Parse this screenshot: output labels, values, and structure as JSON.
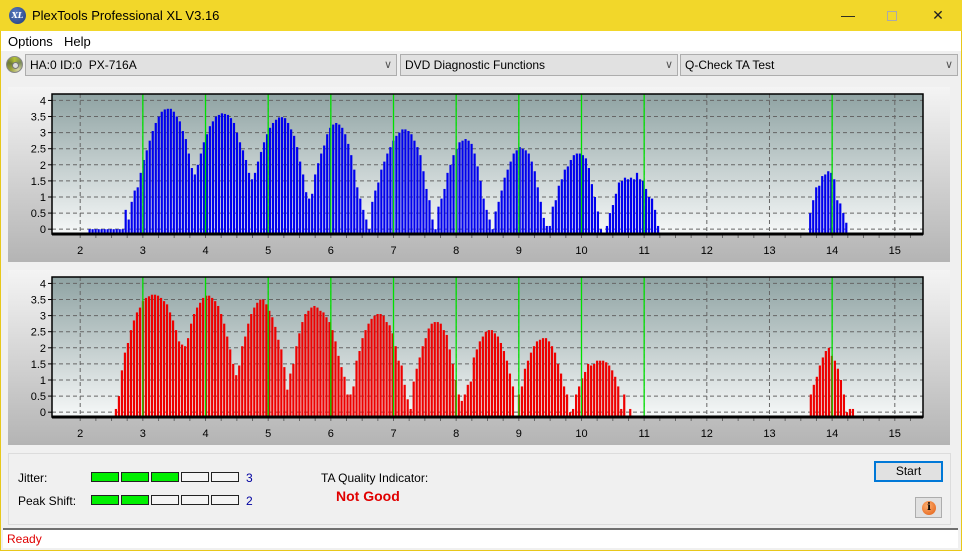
{
  "window": {
    "title": "PlexTools Professional XL V3.16",
    "logo_text": "XL",
    "controls": [
      "minimize",
      "maximize",
      "close"
    ]
  },
  "menu": {
    "items": [
      "Options",
      "Help"
    ]
  },
  "toolbar": {
    "drive": "HA:0 ID:0  PX-716A",
    "function_group": "DVD Diagnostic Functions",
    "test": "Q-Check TA Test"
  },
  "results": {
    "jitter_label": "Jitter:",
    "jitter_value": "3",
    "jitter_level": 3,
    "peak_shift_label": "Peak Shift:",
    "peak_shift_value": "2",
    "peak_shift_level": 2,
    "segments_total": 5,
    "ta_quality_label": "TA Quality Indicator:",
    "ta_quality_value": "Not Good"
  },
  "buttons": {
    "start": "Start",
    "info": "i"
  },
  "status": {
    "text": "Ready"
  },
  "colors": {
    "accent": "#0078d7",
    "title_bar": "#f2d72a",
    "good_segment": "#00f000",
    "bad_text": "#e00000",
    "series_inner": "#0000ee",
    "series_outer": "#ee0000",
    "marker": "#00e000"
  },
  "chart_data": [
    {
      "type": "bar",
      "name": "Inner (top) TA histogram",
      "xlim": [
        1.55,
        15.45
      ],
      "ylim": [
        -0.15,
        4.2
      ],
      "xticks": [
        "2",
        "3",
        "4",
        "5",
        "6",
        "7",
        "8",
        "9",
        "10",
        "11",
        "12",
        "13",
        "14",
        "15"
      ],
      "yticks": [
        "0",
        "0.5",
        "1",
        "1.5",
        "2",
        "2.5",
        "3",
        "3.5",
        "4"
      ],
      "markers": [
        3,
        4,
        5,
        6,
        7,
        8,
        9,
        10,
        11,
        14
      ],
      "grid": true,
      "color": "#0000ee",
      "x_start": 2.15,
      "x_step": 0.048,
      "values": [
        0,
        0,
        0,
        0,
        0,
        0,
        0,
        0,
        0,
        0,
        0,
        0,
        0.6,
        0.3,
        0.85,
        1.2,
        1.3,
        1.75,
        2.15,
        2.45,
        2.75,
        3.05,
        3.3,
        3.5,
        3.65,
        3.72,
        3.74,
        3.74,
        3.65,
        3.5,
        3.35,
        3.05,
        2.8,
        2.35,
        1.9,
        1.7,
        2.0,
        2.35,
        2.7,
        2.95,
        3.2,
        3.35,
        3.5,
        3.55,
        3.6,
        3.58,
        3.55,
        3.45,
        3.3,
        3.0,
        2.7,
        2.45,
        2.15,
        1.75,
        1.55,
        1.75,
        2.1,
        2.4,
        2.7,
        2.95,
        3.15,
        3.3,
        3.4,
        3.47,
        3.48,
        3.45,
        3.3,
        3.1,
        2.9,
        2.55,
        2.1,
        1.7,
        1.15,
        0.95,
        1.1,
        1.7,
        2.05,
        2.35,
        2.6,
        2.95,
        3.15,
        3.25,
        3.3,
        3.25,
        3.15,
        2.95,
        2.65,
        2.3,
        1.85,
        1.3,
        0.95,
        0.6,
        0.3,
        0,
        0.85,
        1.2,
        1.45,
        1.85,
        2.1,
        2.35,
        2.55,
        2.75,
        2.9,
        3.0,
        3.1,
        3.1,
        3.05,
        2.95,
        2.75,
        2.55,
        2.3,
        1.8,
        1.25,
        0.9,
        0.3,
        0,
        0.7,
        0.95,
        1.25,
        1.75,
        2.0,
        2.3,
        2.5,
        2.7,
        2.75,
        2.8,
        2.75,
        2.65,
        2.35,
        1.95,
        1.5,
        0.95,
        0.6,
        0.3,
        0,
        0.55,
        0.85,
        1.2,
        1.6,
        1.85,
        2.1,
        2.35,
        2.45,
        2.55,
        2.5,
        2.45,
        2.35,
        2.1,
        1.8,
        1.3,
        0.85,
        0.35,
        0.1,
        0.1,
        0.7,
        0.9,
        1.35,
        1.55,
        1.85,
        1.95,
        2.15,
        2.3,
        2.35,
        2.35,
        2.3,
        2.2,
        1.9,
        1.4,
        1.0,
        0.55,
        0,
        null,
        0.1,
        0.5,
        0.75,
        1.1,
        1.45,
        1.5,
        1.6,
        1.55,
        1.6,
        1.55,
        1.75,
        1.55,
        1.5,
        1.25,
        1.0,
        0.95,
        0.6,
        0.1
      ],
      "values_b_x_start": 13.65,
      "values_b": [
        0.5,
        0.9,
        1.3,
        1.35,
        1.65,
        1.7,
        1.8,
        1.75,
        1.55,
        0.9,
        0.8,
        0.5,
        0.2
      ]
    },
    {
      "type": "bar",
      "name": "Outer (bottom) TA histogram",
      "xlim": [
        1.55,
        15.45
      ],
      "ylim": [
        -0.15,
        4.2
      ],
      "xticks": [
        "2",
        "3",
        "4",
        "5",
        "6",
        "7",
        "8",
        "9",
        "10",
        "11",
        "12",
        "13",
        "14",
        "15"
      ],
      "yticks": [
        "0",
        "0.5",
        "1",
        "1.5",
        "2",
        "2.5",
        "3",
        "3.5",
        "4"
      ],
      "markers": [
        3,
        4,
        5,
        6,
        7,
        8,
        9,
        10,
        11,
        14
      ],
      "grid": true,
      "color": "#ee0000",
      "x_start": 2.57,
      "x_step": 0.048,
      "values": [
        0.1,
        0.5,
        1.3,
        1.85,
        2.15,
        2.55,
        2.85,
        3.1,
        3.25,
        3.45,
        3.55,
        3.6,
        3.65,
        3.65,
        3.62,
        3.55,
        3.45,
        3.35,
        3.1,
        2.85,
        2.55,
        2.2,
        2.1,
        2.05,
        2.3,
        2.75,
        3.05,
        3.25,
        3.4,
        3.55,
        3.62,
        3.62,
        3.55,
        3.45,
        3.3,
        3.05,
        2.75,
        2.35,
        1.95,
        1.5,
        1.15,
        1.45,
        2.05,
        2.35,
        2.75,
        3.05,
        3.25,
        3.4,
        3.5,
        3.5,
        3.35,
        3.15,
        2.95,
        2.65,
        2.25,
        1.95,
        1.4,
        0.7,
        1.2,
        1.5,
        2.05,
        2.45,
        2.8,
        3.05,
        3.15,
        3.25,
        3.3,
        3.25,
        3.15,
        3.1,
        2.95,
        2.8,
        2.55,
        2.2,
        1.75,
        1.4,
        1.1,
        0.55,
        0.55,
        0.8,
        1.6,
        1.9,
        2.3,
        2.55,
        2.75,
        2.9,
        3.0,
        3.05,
        3.05,
        3.0,
        2.8,
        2.7,
        2.45,
        2.05,
        1.6,
        1.45,
        0.85,
        0.4,
        0.1,
        0.95,
        1.35,
        1.7,
        2.05,
        2.3,
        2.6,
        2.75,
        2.8,
        2.8,
        2.75,
        2.55,
        2.4,
        1.95,
        1.5,
        1.0,
        0.55,
        0.35,
        0.55,
        0.85,
        0.95,
        1.7,
        1.95,
        2.2,
        2.35,
        2.5,
        2.55,
        2.55,
        2.45,
        2.35,
        2.15,
        1.9,
        1.6,
        1.2,
        0.8,
        null,
        0.55,
        0.8,
        1.35,
        1.6,
        1.85,
        2.05,
        2.2,
        2.25,
        2.3,
        2.3,
        2.2,
        2.05,
        1.85,
        1.5,
        1.2,
        0.8,
        0.55,
        0,
        0.1,
        0.55,
        0.8,
        1.05,
        1.25,
        1.5,
        1.45,
        1.5,
        1.6,
        1.6,
        1.6,
        1.55,
        1.45,
        1.3,
        1.1,
        0.8,
        0.1,
        0.55,
        null,
        0.1
      ],
      "values_b_x_start": 13.66,
      "values_b": [
        0.55,
        0.85,
        1.1,
        1.45,
        1.7,
        1.9,
        2.0,
        1.75,
        1.6,
        1.35,
        1.0,
        0.55,
        0,
        0.1,
        0.1
      ]
    }
  ]
}
